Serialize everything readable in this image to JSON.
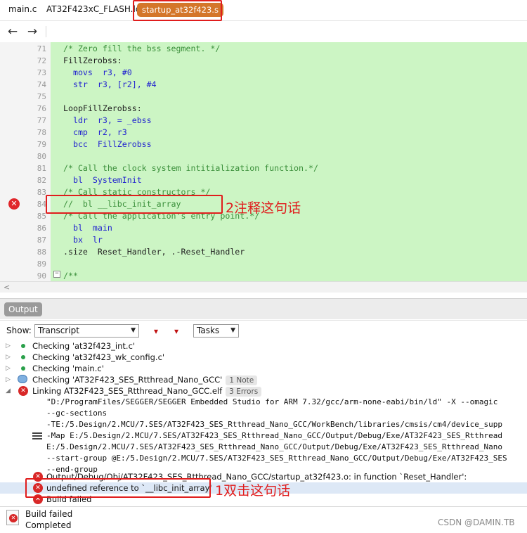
{
  "tabs": [
    {
      "label": "main.c"
    },
    {
      "label": "AT32F423xC_FLASH.ld"
    },
    {
      "label": "startup_at32f423.s"
    }
  ],
  "nav": {
    "back_icon": "arrow-left-icon",
    "forward_icon": "arrow-right-icon",
    "back": "←",
    "forward": "→"
  },
  "editor": {
    "lines": [
      {
        "num": "71",
        "text": "/* Zero fill the bss segment. */"
      },
      {
        "num": "72",
        "text": "FillZerobss:"
      },
      {
        "num": "73",
        "text": "  movs  r3, #0"
      },
      {
        "num": "74",
        "text": "  str  r3, [r2], #4"
      },
      {
        "num": "75",
        "text": ""
      },
      {
        "num": "76",
        "text": "LoopFillZerobss:"
      },
      {
        "num": "77",
        "text": "  ldr  r3, = _ebss"
      },
      {
        "num": "78",
        "text": "  cmp  r2, r3"
      },
      {
        "num": "79",
        "text": "  bcc  FillZerobss"
      },
      {
        "num": "80",
        "text": ""
      },
      {
        "num": "81",
        "text": "/* Call the clock system intitialization function.*/"
      },
      {
        "num": "82",
        "text": "  bl  SystemInit"
      },
      {
        "num": "83",
        "text": "/* Call static constructors */"
      },
      {
        "num": "84",
        "text": "//  bl __libc_init_array"
      },
      {
        "num": "85",
        "text": "/* Call the application's entry point.*/"
      },
      {
        "num": "86",
        "text": "  bl  main"
      },
      {
        "num": "87",
        "text": "  bx  lr"
      },
      {
        "num": "88",
        "text": ".size  Reset_Handler, .-Reset_Handler"
      },
      {
        "num": "89",
        "text": ""
      },
      {
        "num": "90",
        "text": "/**"
      }
    ],
    "error_marker": "✕",
    "fold_marker": "−",
    "annotation": "2注释这句话"
  },
  "scroll": {
    "left_arrow": "<"
  },
  "output": {
    "tab_label": "Output",
    "show_label": "Show:",
    "show_value": "Transcript",
    "tasks_value": "Tasks",
    "combo_arrow": "▼",
    "prev_error_icon": "previous-error-icon",
    "next_error_icon": "next-error-icon",
    "prev_glyph": "▾",
    "next_glyph": "▾",
    "rows": [
      {
        "text": "Checking 'at32f423_int.c'"
      },
      {
        "text": "Checking 'at32f423_wk_config.c'"
      },
      {
        "text": "Checking 'main.c'"
      },
      {
        "text": "Checking 'AT32F423_SES_Rtthread_Nano_GCC'",
        "badge": "1 Note"
      },
      {
        "text": "Linking AT32F423_SES_Rtthread_Nano_GCC.elf",
        "badge": "3 Errors"
      },
      {
        "text": "\"D:/ProgramFiles/SEGGER/SEGGER Embedded Studio for ARM 7.32/gcc/arm-none-eabi/bin/ld\" -X --omagic"
      },
      {
        "text": "--gc-sections"
      },
      {
        "text": "-TE:/5.Design/2.MCU/7.SES/AT32F423_SES_Rtthread_Nano_GCC/WorkBench/libraries/cmsis/cm4/device_supp"
      },
      {
        "text": "-Map E:/5.Design/2.MCU/7.SES/AT32F423_SES_Rtthread_Nano_GCC/Output/Debug/Exe/AT32F423_SES_Rtthread"
      },
      {
        "text": "E:/5.Design/2.MCU/7.SES/AT32F423_SES_Rtthread_Nano_GCC/Output/Debug/Exe/AT32F423_SES_Rtthread_Nano"
      },
      {
        "text": "--start-group @E:/5.Design/2.MCU/7.SES/AT32F423_SES_Rtthread_Nano_GCC/Output/Debug/Exe/AT32F423_SES"
      },
      {
        "text": "--end-group"
      },
      {
        "text": "Output/Debug/Obj/AT32F423_SES_Rtthread_Nano_GCC/startup_at32f423.o: in function `Reset_Handler':"
      },
      {
        "text": "undefined reference to `__libc_init_array'"
      },
      {
        "text": "Build failed"
      }
    ],
    "annotation": "1双击这句话",
    "expand_glyph": "▷",
    "collapse_glyph": "◢",
    "error_glyph": "✕"
  },
  "status": {
    "line1": "Build failed",
    "line2": "Completed",
    "error_glyph": "✕"
  },
  "watermark": "CSDN @DAMIN.TB",
  "colors": {
    "accent": "#d4762a",
    "code_bg": "#ccf5c4",
    "annotation": "#e01d1d",
    "error": "#d82828"
  }
}
